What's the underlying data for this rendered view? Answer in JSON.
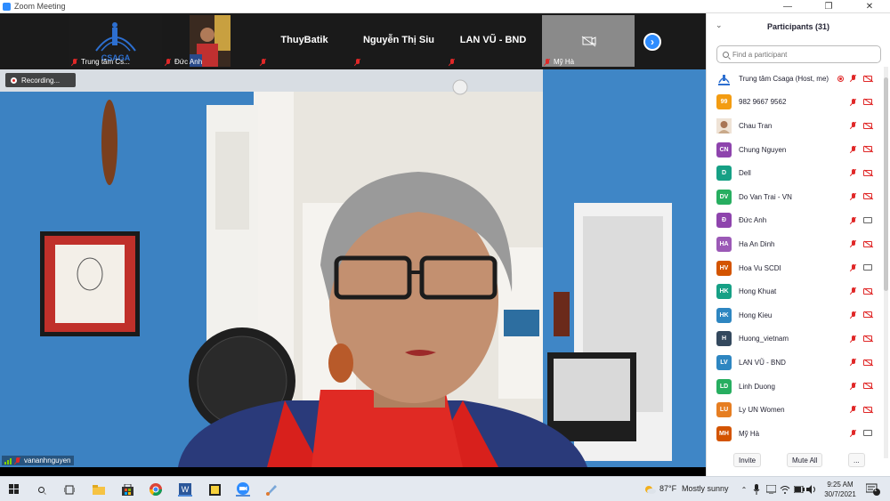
{
  "window": {
    "title": "Zoom Meeting"
  },
  "gallery": {
    "tiles": [
      {
        "name": "Trung tâm Cs...",
        "type": "logo",
        "logo_text": "CSAGA"
      },
      {
        "name": "Đức Anh",
        "type": "video"
      },
      {
        "name": "",
        "center_name": "ThuyBatik",
        "type": "name"
      },
      {
        "name": "",
        "center_name": "Nguyễn Thị Siu",
        "type": "name"
      },
      {
        "name": "",
        "center_name": "LAN VŨ  - BND",
        "type": "name"
      },
      {
        "name": "Mỹ Hà",
        "type": "camoff"
      }
    ]
  },
  "video": {
    "recording_label": "Recording...",
    "speaker_name": "vananhnguyen"
  },
  "participants": {
    "title": "Participants (31)",
    "search_placeholder": "Find a participant",
    "items": [
      {
        "name": "Trung tâm Csaga (Host, me)",
        "initials": "",
        "color": "#ffffff",
        "logo": true,
        "host": true,
        "cam": "off"
      },
      {
        "name": "982 9667 9562",
        "initials": "99",
        "color": "#f39c12",
        "cam": "off"
      },
      {
        "name": "Chau Tran",
        "initials": "",
        "color": "#c9a98a",
        "photo": true,
        "cam": "off"
      },
      {
        "name": "Chung Nguyen",
        "initials": "CN",
        "color": "#8e44ad",
        "cam": "off"
      },
      {
        "name": "Dell",
        "initials": "D",
        "color": "#16a085",
        "cam": "off"
      },
      {
        "name": "Do Van Trai - VN",
        "initials": "DV",
        "color": "#27ae60",
        "cam": "off"
      },
      {
        "name": "Đức Anh",
        "initials": "Đ",
        "color": "#8e44ad",
        "cam": "on"
      },
      {
        "name": "Ha An Dinh",
        "initials": "HA",
        "color": "#9b59b6",
        "cam": "off"
      },
      {
        "name": "Hoa Vu SCDI",
        "initials": "HV",
        "color": "#d35400",
        "cam": "on"
      },
      {
        "name": "Hong Khuat",
        "initials": "HK",
        "color": "#16a085",
        "cam": "off"
      },
      {
        "name": "Hong Kieu",
        "initials": "HK",
        "color": "#2e86c1",
        "cam": "off"
      },
      {
        "name": "Huong_vietnam",
        "initials": "H",
        "color": "#34495e",
        "cam": "off"
      },
      {
        "name": "LAN VŨ  - BND",
        "initials": "LV",
        "color": "#2e86c1",
        "cam": "off"
      },
      {
        "name": "Linh Duong",
        "initials": "LD",
        "color": "#27ae60",
        "cam": "off"
      },
      {
        "name": "Ly UN Women",
        "initials": "LU",
        "color": "#e67e22",
        "cam": "off"
      },
      {
        "name": "Mỹ Hà",
        "initials": "MH",
        "color": "#d35400",
        "cam": "on"
      }
    ],
    "invite_label": "Invite",
    "mute_all_label": "Mute All",
    "more_label": "..."
  },
  "taskbar": {
    "weather_temp": "87°F",
    "weather_text": "Mostly sunny",
    "time": "9:25 AM",
    "date": "30/7/2021",
    "notifications": "1"
  }
}
